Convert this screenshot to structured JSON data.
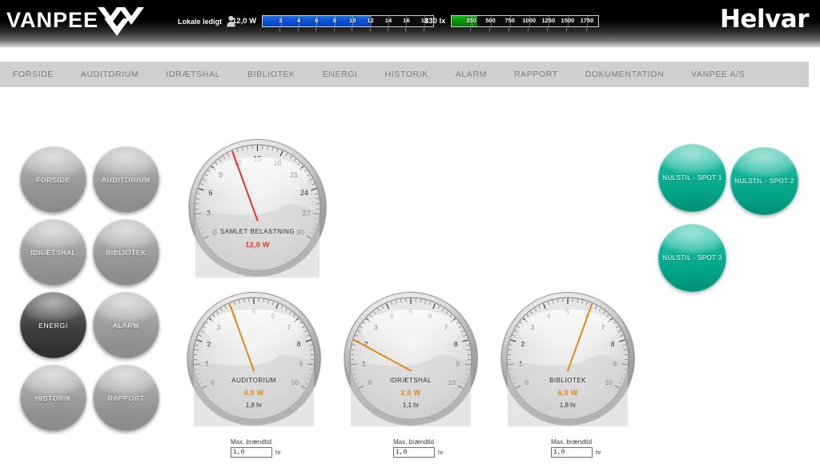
{
  "header": {
    "logo_text": "VANPEE",
    "logo_mark": "vanpee-chevron-logo",
    "brand": "Helvar",
    "occupancy_label": "Lokale ledigt",
    "occupancy_icon": "person-icon",
    "power": {
      "value_label": "12,0 W",
      "value": 12.0,
      "max": 19,
      "ticks": [
        2,
        4,
        6,
        8,
        10,
        12,
        14,
        16,
        18
      ],
      "fill_color": "#0b4fd0"
    },
    "lux": {
      "value_label": "330 lx",
      "value": 330,
      "max": 1900,
      "ticks": [
        250,
        500,
        750,
        1000,
        1250,
        1500,
        1750
      ],
      "fill_color": "#089008"
    }
  },
  "nav": {
    "items": [
      {
        "label": "FORSIDE"
      },
      {
        "label": "AUDITORIUM"
      },
      {
        "label": "IDRÆTSHAL"
      },
      {
        "label": "BIBLIOTEK"
      },
      {
        "label": "ENERGI"
      },
      {
        "label": "HISTORIK"
      },
      {
        "label": "ALARM"
      },
      {
        "label": "RAPPORT"
      },
      {
        "label": "DOKUMENTATION"
      },
      {
        "label": "VANPEE A/S"
      }
    ]
  },
  "side_buttons": [
    {
      "label": "FORSIDE",
      "active": false
    },
    {
      "label": "AUDITORIUM",
      "active": false
    },
    {
      "label": "IDRÆTSHAL",
      "active": false
    },
    {
      "label": "BIBLIOTEK",
      "active": false
    },
    {
      "label": "ENERGI",
      "active": true
    },
    {
      "label": "ALARM",
      "active": false
    },
    {
      "label": "HISTORIK",
      "active": false
    },
    {
      "label": "RAPPORT",
      "active": false
    }
  ],
  "reset_buttons": [
    {
      "label": "NULSTIL - SPOT 1"
    },
    {
      "label": "NULSTIL - SPOT 2"
    },
    {
      "label": "NULSTIL - SPOT 3"
    }
  ],
  "main_gauge": {
    "caption": "SAMLET BELASTNING",
    "value_label": "12,0 W",
    "value": 12.0,
    "min": 0,
    "max": 30,
    "tick_labels": [
      0,
      3,
      6,
      9,
      12,
      15,
      18,
      21,
      24,
      27,
      30
    ],
    "needle_color": "#e8312b",
    "value_color": "#e8312b"
  },
  "zone_gauges": [
    {
      "caption": "AUDITORIUM",
      "value_label": "4,0 W",
      "value": 4.0,
      "min": 0,
      "max": 10,
      "tick_labels": [
        0,
        1,
        2,
        3,
        4,
        5,
        6,
        7,
        8,
        9,
        10
      ],
      "hours_label": "1,8 hr",
      "needle_color": "#e08a14",
      "value_color": "#e08a14",
      "input": {
        "label": "Max. brændtid",
        "value": "1,0",
        "unit": "hr",
        "placeholder": "0,0"
      }
    },
    {
      "caption": "IDRÆTSHAL",
      "value_label": "2,0 W",
      "value": 2.0,
      "min": 0,
      "max": 10,
      "tick_labels": [
        0,
        1,
        2,
        3,
        4,
        5,
        6,
        7,
        8,
        9,
        10
      ],
      "hours_label": "1,1 hr",
      "needle_color": "#e08a14",
      "value_color": "#e08a14",
      "input": {
        "label": "Max. brændtid",
        "value": "1,0",
        "unit": "hr",
        "placeholder": "0,0"
      }
    },
    {
      "caption": "BIBLIOTEK",
      "value_label": "6,0 W",
      "value": 6.0,
      "min": 0,
      "max": 10,
      "tick_labels": [
        0,
        1,
        2,
        3,
        4,
        5,
        6,
        7,
        8,
        9,
        10
      ],
      "hours_label": "1,8 hr",
      "needle_color": "#e08a14",
      "value_color": "#e08a14",
      "input": {
        "label": "Max. brændtid",
        "value": "1,0",
        "unit": "hr",
        "placeholder": "0,0"
      }
    }
  ],
  "colors": {
    "page_bg": "#ffffff",
    "nav_bg": "#cfcfcf",
    "nav_text": "#7d7d7d",
    "accent_green": "#05a98c",
    "accent_red": "#e8312b",
    "accent_orange": "#e08a14"
  }
}
